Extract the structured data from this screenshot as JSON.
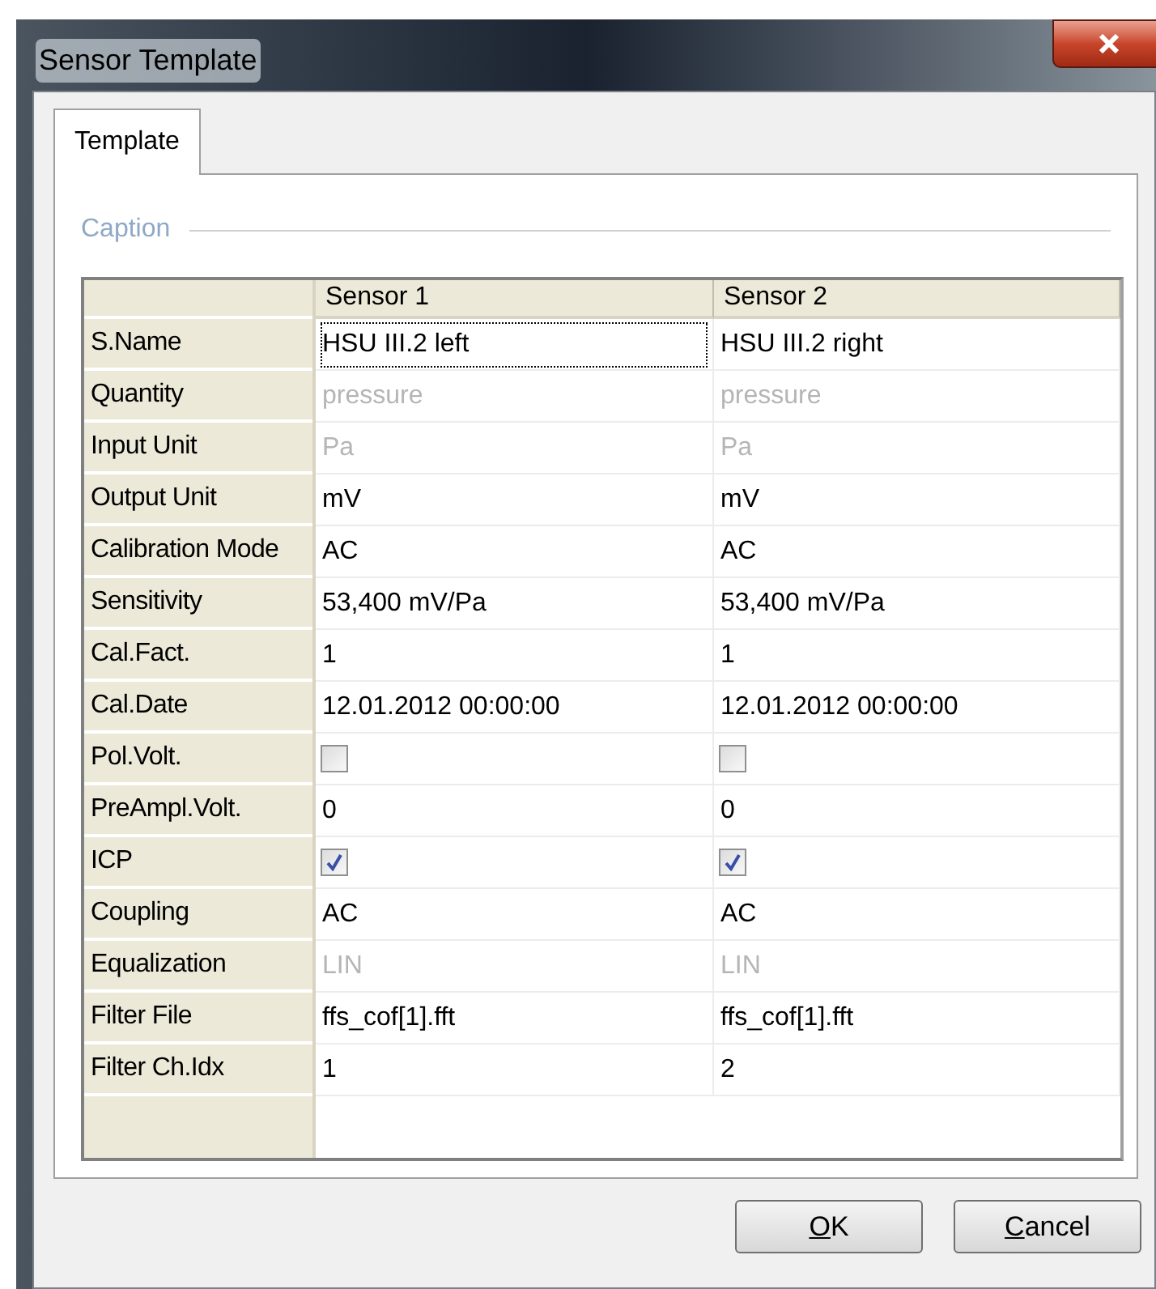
{
  "window": {
    "title": "Sensor Template"
  },
  "tabs": [
    {
      "label": "Template",
      "selected": true
    }
  ],
  "caption": "Caption",
  "grid": {
    "columns": [
      "Sensor 1",
      "Sensor 2"
    ],
    "rows": [
      {
        "label": "S.Name",
        "cells": [
          {
            "kind": "text",
            "value": "HSU III.2 left",
            "disabled": false,
            "focused": true
          },
          {
            "kind": "text",
            "value": "HSU III.2 right",
            "disabled": false,
            "focused": false
          }
        ]
      },
      {
        "label": "Quantity",
        "cells": [
          {
            "kind": "text",
            "value": "pressure",
            "disabled": true,
            "focused": false
          },
          {
            "kind": "text",
            "value": "pressure",
            "disabled": true,
            "focused": false
          }
        ]
      },
      {
        "label": "Input Unit",
        "cells": [
          {
            "kind": "text",
            "value": "Pa",
            "disabled": true,
            "focused": false
          },
          {
            "kind": "text",
            "value": "Pa",
            "disabled": true,
            "focused": false
          }
        ]
      },
      {
        "label": "Output Unit",
        "cells": [
          {
            "kind": "text",
            "value": "mV",
            "disabled": false,
            "focused": false
          },
          {
            "kind": "text",
            "value": "mV",
            "disabled": false,
            "focused": false
          }
        ]
      },
      {
        "label": "Calibration Mode",
        "cells": [
          {
            "kind": "text",
            "value": "AC",
            "disabled": false,
            "focused": false
          },
          {
            "kind": "text",
            "value": "AC",
            "disabled": false,
            "focused": false
          }
        ]
      },
      {
        "label": "Sensitivity",
        "cells": [
          {
            "kind": "text",
            "value": "53,400 mV/Pa",
            "disabled": false,
            "focused": false
          },
          {
            "kind": "text",
            "value": "53,400 mV/Pa",
            "disabled": false,
            "focused": false
          }
        ]
      },
      {
        "label": "Cal.Fact.",
        "cells": [
          {
            "kind": "text",
            "value": "1",
            "disabled": false,
            "focused": false
          },
          {
            "kind": "text",
            "value": "1",
            "disabled": false,
            "focused": false
          }
        ]
      },
      {
        "label": "Cal.Date",
        "cells": [
          {
            "kind": "text",
            "value": "12.01.2012 00:00:00",
            "disabled": false,
            "focused": false
          },
          {
            "kind": "text",
            "value": "12.01.2012 00:00:00",
            "disabled": false,
            "focused": false
          }
        ]
      },
      {
        "label": "Pol.Volt.",
        "cells": [
          {
            "kind": "checkbox",
            "checked": false
          },
          {
            "kind": "checkbox",
            "checked": false
          }
        ]
      },
      {
        "label": "PreAmpl.Volt.",
        "cells": [
          {
            "kind": "text",
            "value": "0",
            "disabled": false,
            "focused": false
          },
          {
            "kind": "text",
            "value": "0",
            "disabled": false,
            "focused": false
          }
        ]
      },
      {
        "label": "ICP",
        "cells": [
          {
            "kind": "checkbox",
            "checked": true
          },
          {
            "kind": "checkbox",
            "checked": true
          }
        ]
      },
      {
        "label": "Coupling",
        "cells": [
          {
            "kind": "text",
            "value": "AC",
            "disabled": false,
            "focused": false
          },
          {
            "kind": "text",
            "value": "AC",
            "disabled": false,
            "focused": false
          }
        ]
      },
      {
        "label": "Equalization",
        "cells": [
          {
            "kind": "text",
            "value": "LIN",
            "disabled": true,
            "focused": false
          },
          {
            "kind": "text",
            "value": "LIN",
            "disabled": true,
            "focused": false
          }
        ]
      },
      {
        "label": "Filter File",
        "cells": [
          {
            "kind": "text",
            "value": "ffs_cof[1].fft",
            "disabled": false,
            "focused": false
          },
          {
            "kind": "text",
            "value": "ffs_cof[1].fft",
            "disabled": false,
            "focused": false
          }
        ]
      },
      {
        "label": "Filter Ch.Idx",
        "cells": [
          {
            "kind": "text",
            "value": "1",
            "disabled": false,
            "focused": false
          },
          {
            "kind": "text",
            "value": "2",
            "disabled": false,
            "focused": false
          }
        ]
      }
    ]
  },
  "buttons": [
    {
      "label": "OK"
    },
    {
      "label": "Cancel"
    }
  ]
}
